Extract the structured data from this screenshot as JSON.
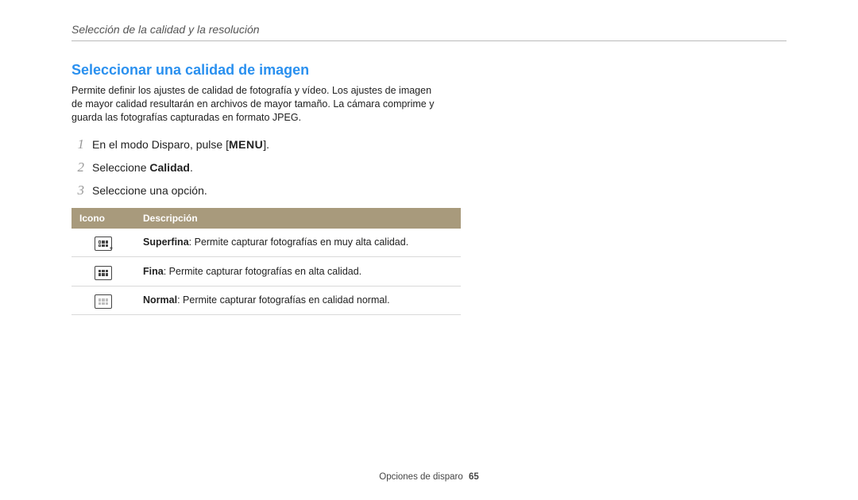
{
  "header": {
    "title": "Selección de la calidad y la resolución"
  },
  "section": {
    "heading": "Seleccionar una calidad de imagen",
    "intro": "Permite definir los ajustes de calidad de fotografía y vídeo. Los ajustes de imagen de mayor calidad resultarán en archivos de mayor tamaño. La cámara comprime y guarda las fotografías capturadas en formato JPEG."
  },
  "steps": [
    {
      "num": "1",
      "pre": "En el modo Disparo, pulse [",
      "key": "MENU",
      "post": "]."
    },
    {
      "num": "2",
      "pre": "Seleccione ",
      "bold": "Calidad",
      "post": "."
    },
    {
      "num": "3",
      "pre": "Seleccione una opción.",
      "bold": "",
      "post": ""
    }
  ],
  "table": {
    "headers": {
      "icon": "Icono",
      "desc": "Descripción"
    },
    "rows": [
      {
        "icon_name": "superfina-icon",
        "bold": "Superfina",
        "rest": ": Permite capturar fotografías en muy alta calidad."
      },
      {
        "icon_name": "fina-icon",
        "bold": "Fina",
        "rest": ": Permite capturar fotografías en alta calidad."
      },
      {
        "icon_name": "normal-icon",
        "bold": "Normal",
        "rest": ": Permite capturar fotografías en calidad normal."
      }
    ]
  },
  "footer": {
    "section": "Opciones de disparo",
    "page": "65"
  }
}
